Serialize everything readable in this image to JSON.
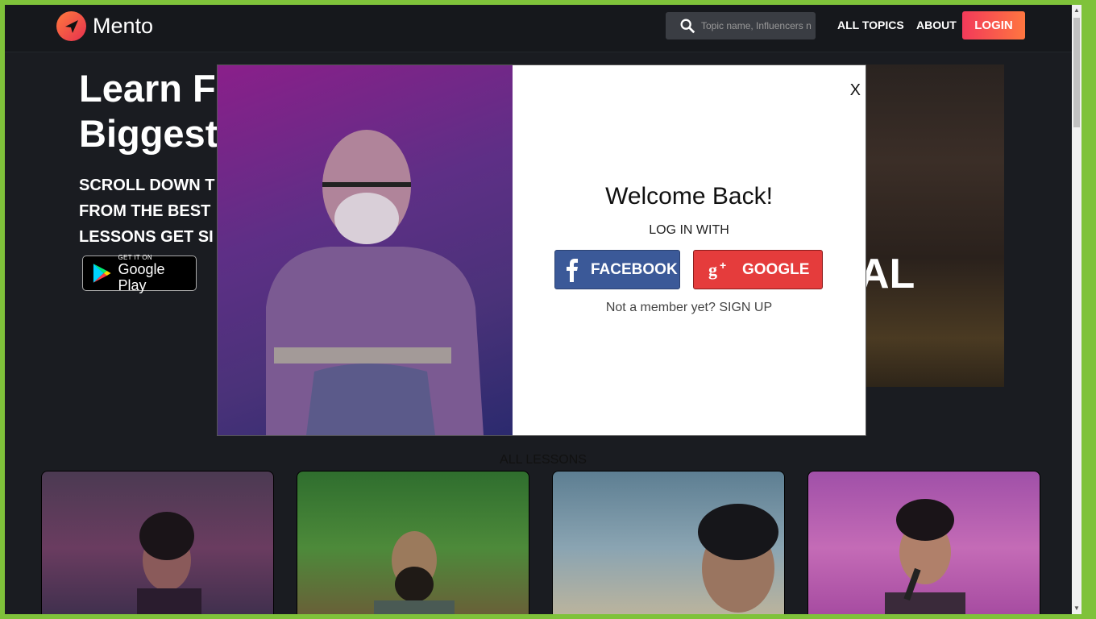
{
  "header": {
    "brand": "Mento",
    "search_placeholder": "Topic name, Influencers n",
    "nav": [
      "ALL TOPICS",
      "ABOUT"
    ],
    "login": "LOGIN"
  },
  "hero": {
    "title_lines": [
      "Learn F",
      "Biggest"
    ],
    "subtitle_lines": [
      "SCROLL DOWN T",
      "FROM THE BEST",
      "LESSONS GET SI"
    ],
    "store_badge": {
      "small": "GET IT ON",
      "big": "Google Play"
    },
    "overlay_text": "AL"
  },
  "modal": {
    "close": "X",
    "title": "Welcome Back!",
    "login_with": "LOG IN WITH",
    "facebook": "FACEBOOK",
    "google": "GOOGLE",
    "signup_prompt": "Not a member yet? SIGN UP"
  },
  "lessons": {
    "heading": "ALL LESSONS"
  },
  "colors": {
    "accent": "#f23a5a",
    "facebook": "#3b5998",
    "google": "#e53c3c",
    "page_bg": "#1a1c21"
  }
}
